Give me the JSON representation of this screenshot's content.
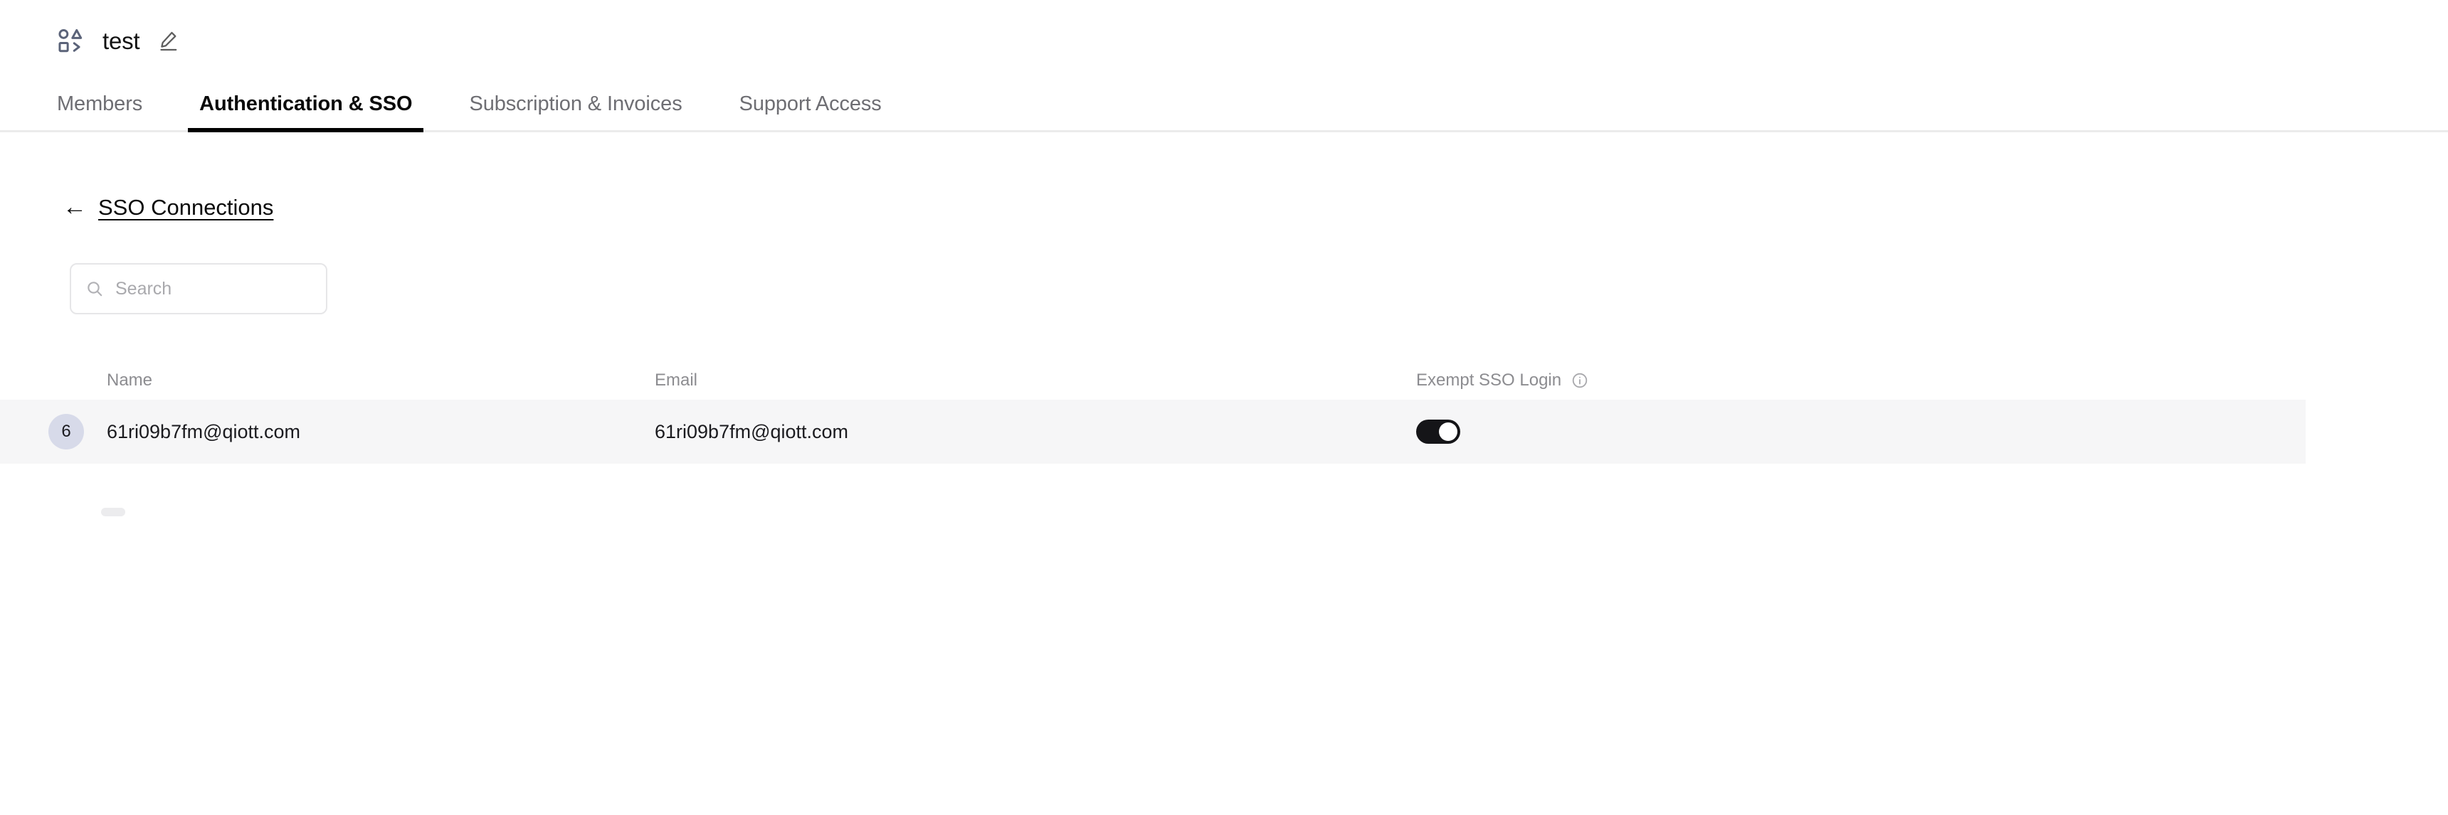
{
  "header": {
    "org_icon": "shapes-grid-icon",
    "title": "test",
    "edit_icon": "pencil-edit-icon"
  },
  "tabs": [
    {
      "label": "Members",
      "active": false
    },
    {
      "label": "Authentication & SSO",
      "active": true
    },
    {
      "label": "Subscription & Invoices",
      "active": false
    },
    {
      "label": "Support Access",
      "active": false
    }
  ],
  "back_link": {
    "arrow": "←",
    "label": "SSO Connections"
  },
  "search": {
    "icon": "search-icon",
    "placeholder": "Search",
    "value": ""
  },
  "table": {
    "columns": [
      {
        "key": "name",
        "label": "Name"
      },
      {
        "key": "email",
        "label": "Email"
      },
      {
        "key": "exempt",
        "label": "Exempt SSO Login",
        "info_icon": "info-circle-icon"
      }
    ],
    "rows": [
      {
        "avatar_initial": "6",
        "name": "61ri09b7fm@qiott.com",
        "email": "61ri09b7fm@qiott.com",
        "exempt_sso_login": true
      }
    ]
  },
  "colors": {
    "active_tab_underline": "#000000",
    "row_background": "#f6f6f7",
    "avatar_background": "#d7dae9",
    "toggle_on": "#151518",
    "muted_text": "#8c8c90"
  }
}
